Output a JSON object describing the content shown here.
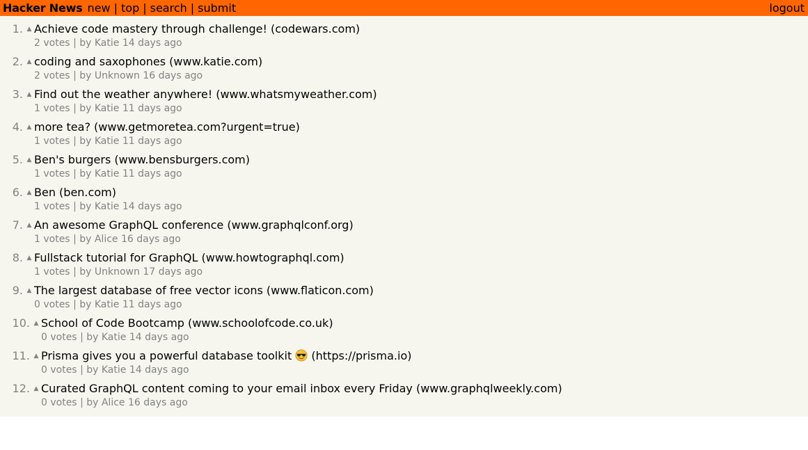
{
  "header": {
    "brand": "Hacker News",
    "nav": [
      {
        "label": "new"
      },
      {
        "label": "top"
      },
      {
        "label": "search"
      },
      {
        "label": "submit"
      }
    ],
    "separator": "|",
    "logout": "logout"
  },
  "colors": {
    "header_bg": "#ff6600",
    "page_bg": "#f6f6ef",
    "meta_text": "#828282"
  },
  "vote_icon": "upvote-triangle-icon",
  "links": [
    {
      "rank": "1.",
      "title": "Achieve code mastery through challenge! (codewars.com)",
      "votes": "2 votes",
      "sep": "|",
      "by": "by Katie",
      "time": "14 days ago"
    },
    {
      "rank": "2.",
      "title": "coding and saxophones (www.katie.com)",
      "votes": "2 votes",
      "sep": "|",
      "by": "by Unknown",
      "time": "16 days ago"
    },
    {
      "rank": "3.",
      "title": "Find out the weather anywhere! (www.whatsmyweather.com)",
      "votes": "1 votes",
      "sep": "|",
      "by": "by Katie",
      "time": "11 days ago"
    },
    {
      "rank": "4.",
      "title": "more tea? (www.getmoretea.com?urgent=true)",
      "votes": "1 votes",
      "sep": "|",
      "by": "by Katie",
      "time": "11 days ago"
    },
    {
      "rank": "5.",
      "title": "Ben's burgers (www.bensburgers.com)",
      "votes": "1 votes",
      "sep": "|",
      "by": "by Katie",
      "time": "11 days ago"
    },
    {
      "rank": "6.",
      "title": "Ben (ben.com)",
      "votes": "1 votes",
      "sep": "|",
      "by": "by Katie",
      "time": "14 days ago"
    },
    {
      "rank": "7.",
      "title": "An awesome GraphQL conference (www.graphqlconf.org)",
      "votes": "1 votes",
      "sep": "|",
      "by": "by Alice",
      "time": "16 days ago"
    },
    {
      "rank": "8.",
      "title": "Fullstack tutorial for GraphQL (www.howtographql.com)",
      "votes": "1 votes",
      "sep": "|",
      "by": "by Unknown",
      "time": "17 days ago"
    },
    {
      "rank": "9.",
      "title": "The largest database of free vector icons (www.flaticon.com)",
      "votes": "0 votes",
      "sep": "|",
      "by": "by Katie",
      "time": "11 days ago"
    },
    {
      "rank": "10.",
      "title": "School of Code Bootcamp (www.schoolofcode.co.uk)",
      "votes": "0 votes",
      "sep": "|",
      "by": "by Katie",
      "time": "14 days ago"
    },
    {
      "rank": "11.",
      "title_before": "Prisma gives you a powerful database toolkit",
      "title_emoji": "sunglasses-emoji-icon",
      "title_after": "(https://prisma.io)",
      "votes": "0 votes",
      "sep": "|",
      "by": "by Katie",
      "time": "14 days ago"
    },
    {
      "rank": "12.",
      "title": "Curated GraphQL content coming to your email inbox every Friday (www.graphqlweekly.com)",
      "votes": "0 votes",
      "sep": "|",
      "by": "by Alice",
      "time": "16 days ago"
    }
  ]
}
